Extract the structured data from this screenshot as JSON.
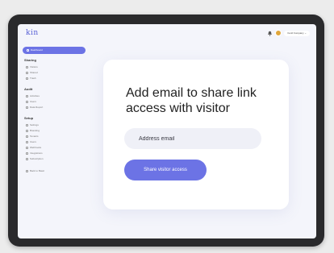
{
  "app": {
    "logo_text": "kin"
  },
  "header": {
    "account_label": "Fenil Company ⌄"
  },
  "sidebar": {
    "active_item": "Dashboard",
    "sections": [
      {
        "title": "Sharing",
        "items": [
          "Visitors",
          "Shared",
          "Trash"
        ]
      },
      {
        "title": "Audit",
        "items": [
          "Activities",
          "Users",
          "Data Report"
        ]
      },
      {
        "title": "Setup",
        "items": [
          "Settings",
          "Branding",
          "Tenants",
          "Users",
          "Webhooks",
          "Integrations",
          "Subscription"
        ]
      }
    ],
    "footer_item": "Back to Basic"
  },
  "card": {
    "title": "Add email to share link access with visitor",
    "email_placeholder": "Address email",
    "share_button_label": "Share visitor access"
  },
  "colors": {
    "accent": "#6c73e5",
    "device_frame": "#2a2a2c",
    "screen_bg": "#f4f5fb",
    "avatar": "#e0a63b"
  }
}
